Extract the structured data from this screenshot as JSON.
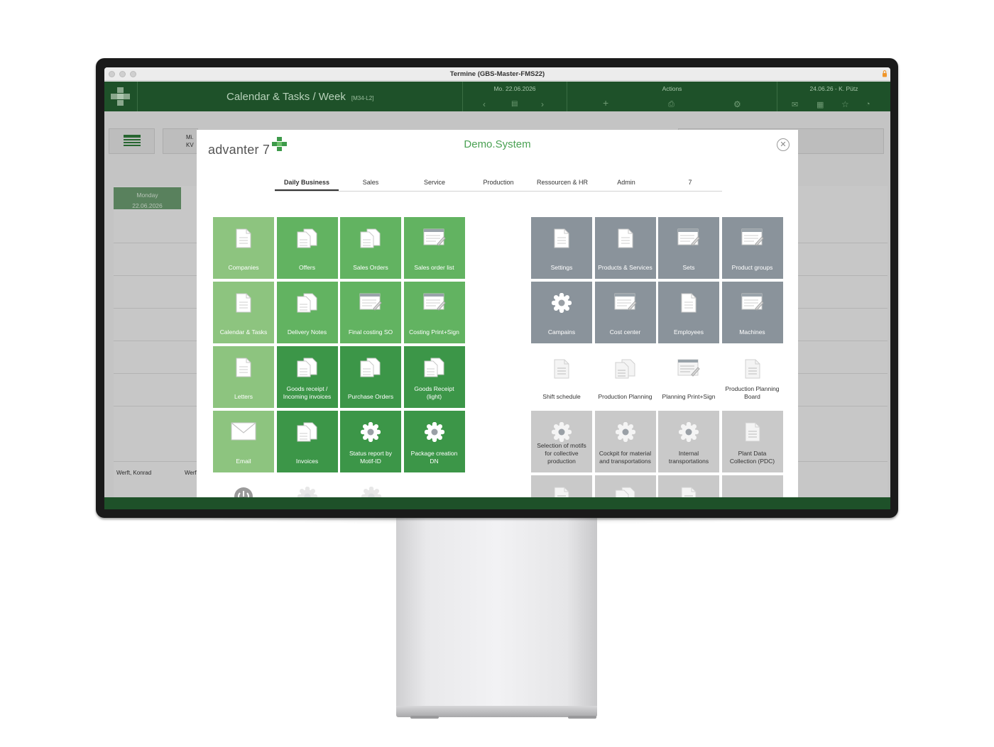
{
  "window": {
    "title": "Termine (GBS-Master-FMS22)"
  },
  "header": {
    "module_title": "Calendar & Tasks / Week",
    "module_code": "[M34-L2]",
    "date_label": "Mo. 22.06.2026",
    "actions_label": "Actions",
    "user_label": "24.06.26 - K. Pütz"
  },
  "background": {
    "day_name": "Monday",
    "day_date": "22.06.2026",
    "week_short": "Mi.",
    "week_short2": "KV",
    "resource_1": "Werft, Konrad",
    "resource_2": "Werf"
  },
  "launcher": {
    "brand": "advanter 7",
    "title": "Demo.System",
    "tabs": [
      {
        "label": "Daily Business",
        "active": true
      },
      {
        "label": "Sales"
      },
      {
        "label": "Service"
      },
      {
        "label": "Production"
      },
      {
        "label": "Ressourcen & HR"
      },
      {
        "label": "Admin"
      },
      {
        "label": "7"
      }
    ],
    "left_tiles": [
      {
        "label": "Companies",
        "icon": "document-icon",
        "color": "light"
      },
      {
        "label": "Offers",
        "icon": "documents-icon",
        "color": "mid"
      },
      {
        "label": "Sales Orders",
        "icon": "documents-icon",
        "color": "mid"
      },
      {
        "label": "Sales order list",
        "icon": "list-edit-icon",
        "color": "mid"
      },
      {
        "label": "Calendar & Tasks",
        "icon": "document-icon",
        "color": "light"
      },
      {
        "label": "Delivery Notes",
        "icon": "documents-icon",
        "color": "mid"
      },
      {
        "label": "Final costing SO",
        "icon": "list-edit-icon",
        "color": "mid"
      },
      {
        "label": "Costing Print+Sign",
        "icon": "list-edit-icon",
        "color": "mid"
      },
      {
        "label": "Letters",
        "icon": "document-icon",
        "color": "light"
      },
      {
        "label": "Goods receipt / Incoming invoices",
        "icon": "documents-icon",
        "color": "dark"
      },
      {
        "label": "Purchase Orders",
        "icon": "documents-icon",
        "color": "dark"
      },
      {
        "label": "Goods Receipt (light)",
        "icon": "documents-icon",
        "color": "dark"
      },
      {
        "label": "Email",
        "icon": "envelope-icon",
        "color": "light"
      },
      {
        "label": "Invoices",
        "icon": "documents-icon",
        "color": "dark"
      },
      {
        "label": "Status report by Motif-ID",
        "icon": "gear-icon",
        "color": "dark"
      },
      {
        "label": "Package creation DN",
        "icon": "gear-icon",
        "color": "dark"
      }
    ],
    "right_tiles": [
      {
        "label": "Settings",
        "icon": "document-icon",
        "color": "grey"
      },
      {
        "label": "Products & Services",
        "icon": "document-icon",
        "color": "grey"
      },
      {
        "label": "Sets",
        "icon": "list-edit-icon",
        "color": "grey"
      },
      {
        "label": "Product groups",
        "icon": "list-edit-icon",
        "color": "grey"
      },
      {
        "label": "Campains",
        "icon": "gear-icon",
        "color": "grey"
      },
      {
        "label": "Cost center",
        "icon": "list-edit-icon",
        "color": "grey"
      },
      {
        "label": "Employees",
        "icon": "document-icon",
        "color": "grey"
      },
      {
        "label": "Machines",
        "icon": "list-edit-icon",
        "color": "grey"
      },
      {
        "label": "Shift schedule",
        "icon": "document-icon",
        "color": "white"
      },
      {
        "label": "Production Planning",
        "icon": "documents-icon",
        "color": "white"
      },
      {
        "label": "Planning Print+Sign",
        "icon": "list-edit-icon",
        "color": "white"
      },
      {
        "label": "Production Planning Board",
        "icon": "document-icon",
        "color": "white"
      },
      {
        "label": "Selection of motifs for collective production",
        "icon": "gear-icon",
        "color": "lgrey"
      },
      {
        "label": "Cockpit for material and transportations",
        "icon": "gear-icon",
        "color": "lgrey"
      },
      {
        "label": "Internal transportations",
        "icon": "gear-icon",
        "color": "lgrey"
      },
      {
        "label": "Plant Data Collection (PDC)",
        "icon": "document-icon",
        "color": "lgrey"
      },
      {
        "label": "",
        "icon": "document-icon",
        "color": "lgrey"
      },
      {
        "label": "",
        "icon": "documents-icon",
        "color": "lgrey"
      },
      {
        "label": "",
        "icon": "document-icon",
        "color": "lgrey"
      },
      {
        "label": "",
        "icon": "dots-icon",
        "color": "lgrey"
      }
    ],
    "bottom_left_icons": [
      "power-icon",
      "gear-icon",
      "gear-icon"
    ]
  },
  "colors": {
    "header_green": "#1e5129",
    "tile_light": "#8dc47f",
    "tile_mid": "#62b361",
    "tile_dark": "#3c9648",
    "tile_grey": "#8a939b",
    "tile_lightgrey": "#c9c9c9",
    "brand_green": "#4aa153"
  }
}
